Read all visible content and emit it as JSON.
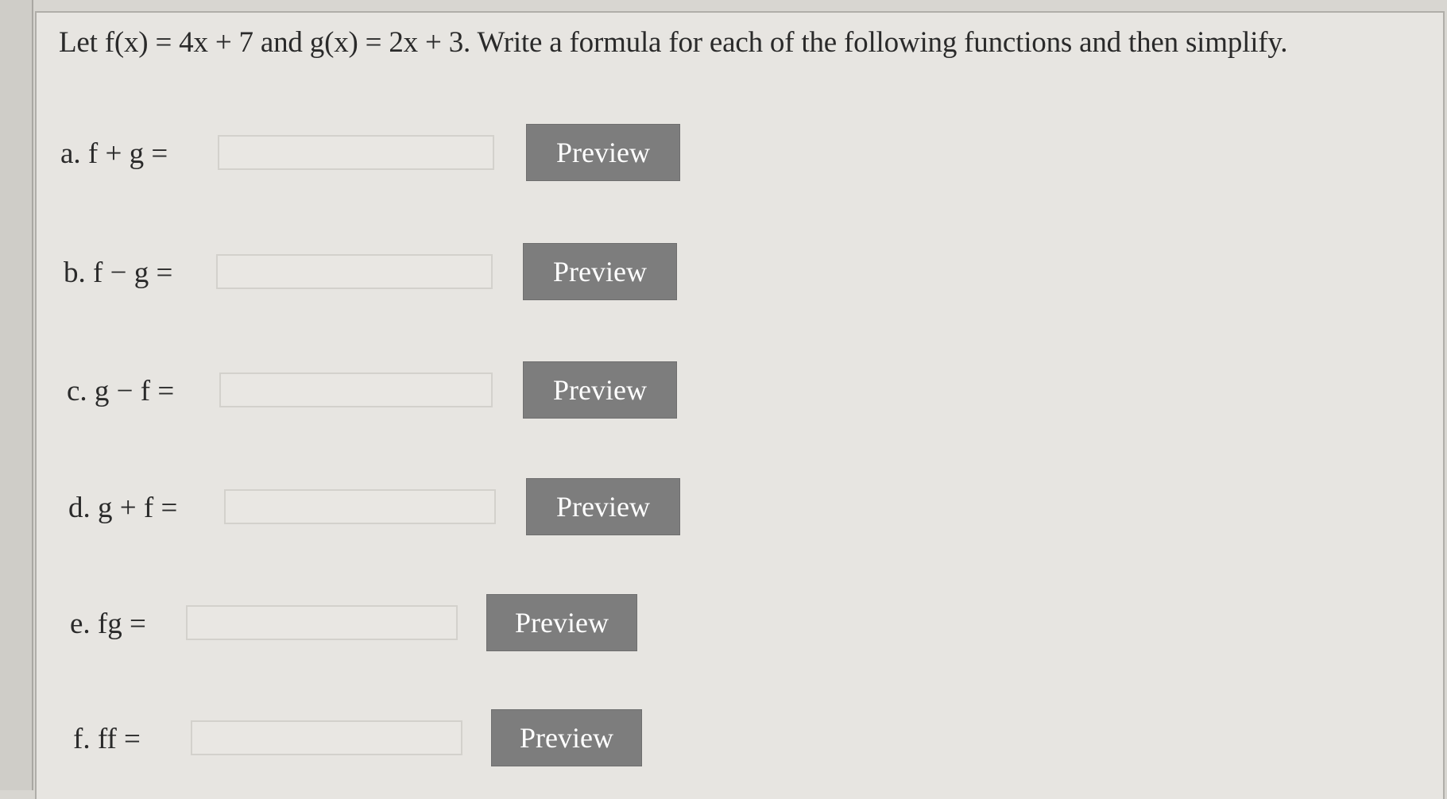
{
  "question": {
    "text": "Let f(x) = 4x + 7 and g(x) = 2x + 3. Write a formula for each of the following functions and then simplify."
  },
  "rows": [
    {
      "label": "a.  f + g =",
      "value": "",
      "preview_label": "Preview"
    },
    {
      "label": "b.  f − g =",
      "value": "",
      "preview_label": "Preview"
    },
    {
      "label": "c.  g − f =",
      "value": "",
      "preview_label": "Preview"
    },
    {
      "label": "d.  g + f =",
      "value": "",
      "preview_label": "Preview"
    },
    {
      "label": "e.  fg =",
      "value": "",
      "preview_label": "Preview"
    },
    {
      "label": "f.  ff =",
      "value": "",
      "preview_label": "Preview"
    }
  ]
}
